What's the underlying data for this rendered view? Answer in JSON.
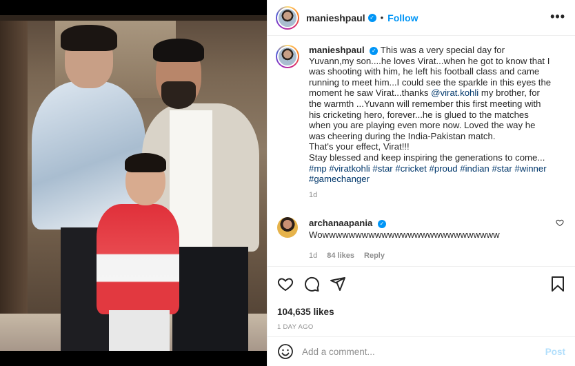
{
  "post": {
    "username": "manieshpaul",
    "verified_icon": "verified-badge-icon",
    "follow_label": "Follow",
    "dot": "•",
    "more_label": "•••"
  },
  "caption": {
    "username": "manieshpaul",
    "text_1": "This was a very special day for Yuvann,my son....he loves Virat...when he got to know that I was shooting with him, he left his football class and came running to meet him...I could see the sparkle in this eyes the moment he saw Virat...thanks ",
    "mention": "@virat.kohli",
    "text_2": " my brother, for the warmth ...Yuvann will remember this first meeting with his cricketing hero, forever...he is glued to the matches when you are playing even more now. Loved the way he was cheering during the India-Pakistan match.",
    "line_effect": "That's your effect, Virat!!!",
    "line_bless": "Stay blessed and keep inspiring the generations to come... ",
    "tags": [
      "#mp",
      "#viratkohli",
      "#star",
      "#cricket",
      "#proud",
      "#indian",
      "#star",
      "#winner",
      "#gamechanger"
    ],
    "time": "1d"
  },
  "comment": {
    "username": "archanaapania",
    "text": "Wowwwwwwwwwwwwwwwwwwwwwwwwwww",
    "time": "1d",
    "likes": "84 likes",
    "reply_label": "Reply"
  },
  "actions": {
    "likes": "104,635 likes",
    "posted": "1 DAY AGO"
  },
  "add_comment": {
    "placeholder": "Add a comment...",
    "post_label": "Post"
  },
  "colors": {
    "accent": "#0095f6",
    "link": "#00376b",
    "muted": "#8e8e8e",
    "post_disabled": "#b2dffc"
  }
}
